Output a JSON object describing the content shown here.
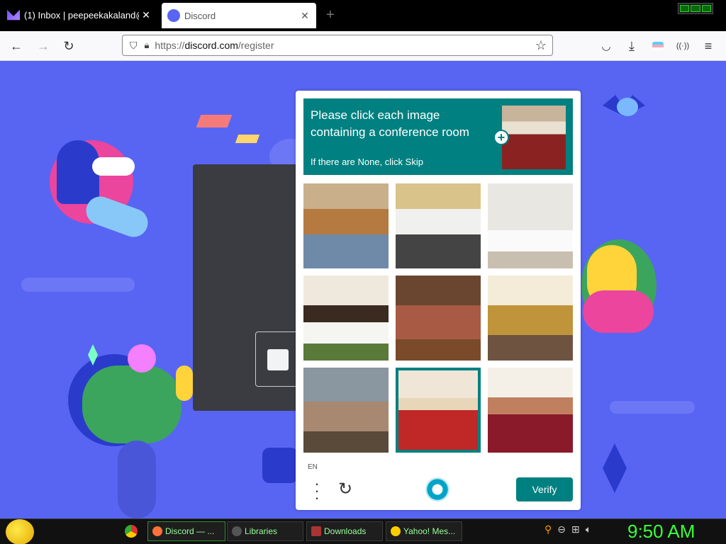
{
  "browser": {
    "tabs": [
      {
        "label": "(1) Inbox | peepeekakaland@pro",
        "icon": "proton-mail-icon"
      },
      {
        "label": "Discord",
        "icon": "discord-icon"
      }
    ],
    "url_prefix": "https://",
    "url_domain": "discord.com",
    "url_path": "/register"
  },
  "captcha": {
    "prompt": "Please click each image containing a conference room",
    "sub": "If there are None, click Skip",
    "tiles": [
      {
        "scene": "conference room",
        "selected": false
      },
      {
        "scene": "conference room",
        "selected": false
      },
      {
        "scene": "hotel room",
        "selected": false
      },
      {
        "scene": "hotel room",
        "selected": false
      },
      {
        "scene": "hotel room",
        "selected": false
      },
      {
        "scene": "hotel room",
        "selected": false
      },
      {
        "scene": "living room",
        "selected": false
      },
      {
        "scene": "conference room",
        "selected": true
      },
      {
        "scene": "conference room",
        "selected": false
      }
    ],
    "lang": "EN",
    "verify_label": "Verify"
  },
  "taskbar": {
    "buttons": [
      "Discord — ...",
      "Libraries",
      "Downloads",
      "Yahoo! Mes..."
    ],
    "clock": "9:50 AM"
  },
  "colors": {
    "discord_bg": "#5865f2",
    "captcha_teal": "#008080",
    "clock_green": "#39ff39"
  }
}
